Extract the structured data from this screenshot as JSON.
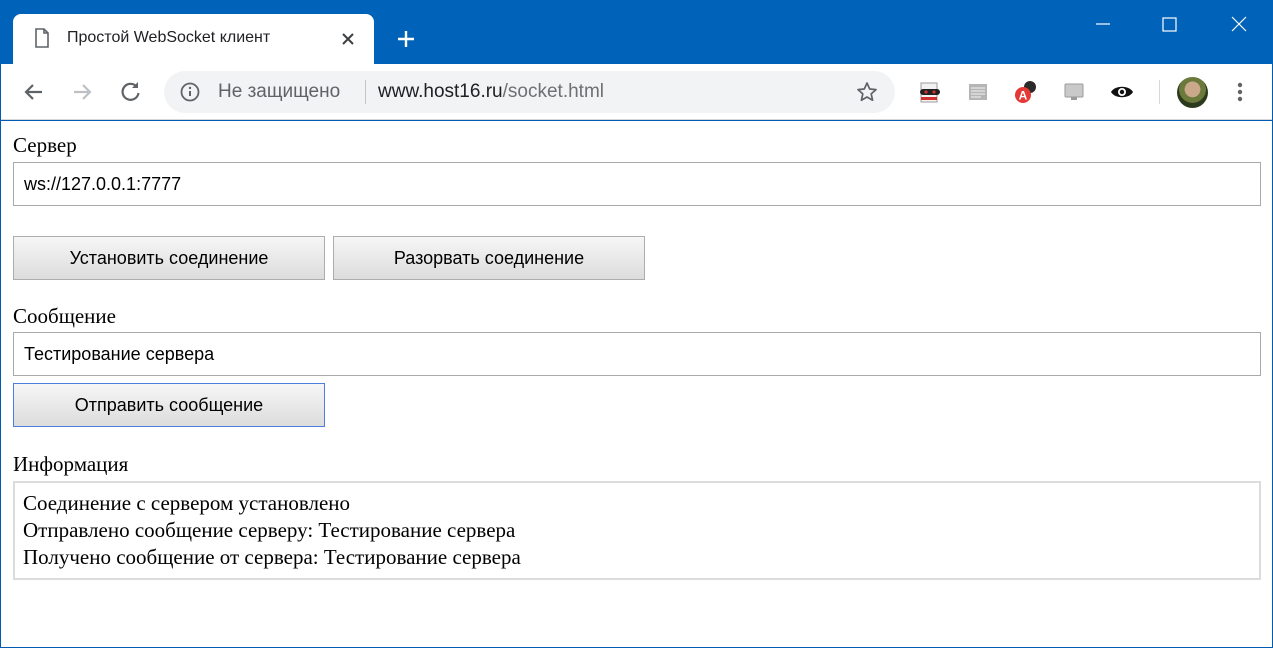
{
  "browser": {
    "tab_title": "Простой WebSocket клиент",
    "security_label": "Не защищено",
    "url_host": "www.host16.ru",
    "url_path": "/socket.html",
    "icons": {
      "tab": "page-icon",
      "close": "close-icon",
      "new_tab": "plus-icon",
      "back": "back-arrow-icon",
      "forward": "forward-arrow-icon",
      "reload": "reload-icon",
      "info": "info-icon",
      "bookmark": "star-icon",
      "menu": "kebab-menu-icon"
    },
    "colors": {
      "frame": "#0062b8",
      "omnibox": "#f1f3f4"
    }
  },
  "page": {
    "server_label": "Сервер",
    "server_value": "ws://127.0.0.1:7777",
    "connect_button": "Установить соединение",
    "disconnect_button": "Разорвать соединение",
    "message_label": "Сообщение",
    "message_value": "Тестирование сервера",
    "send_button": "Отправить сообщение",
    "info_label": "Информация",
    "log": [
      "Соединение с сервером установлено",
      "Отправлено сообщение серверу: Тестирование сервера",
      "Получено сообщение от сервера: Тестирование сервера"
    ]
  }
}
